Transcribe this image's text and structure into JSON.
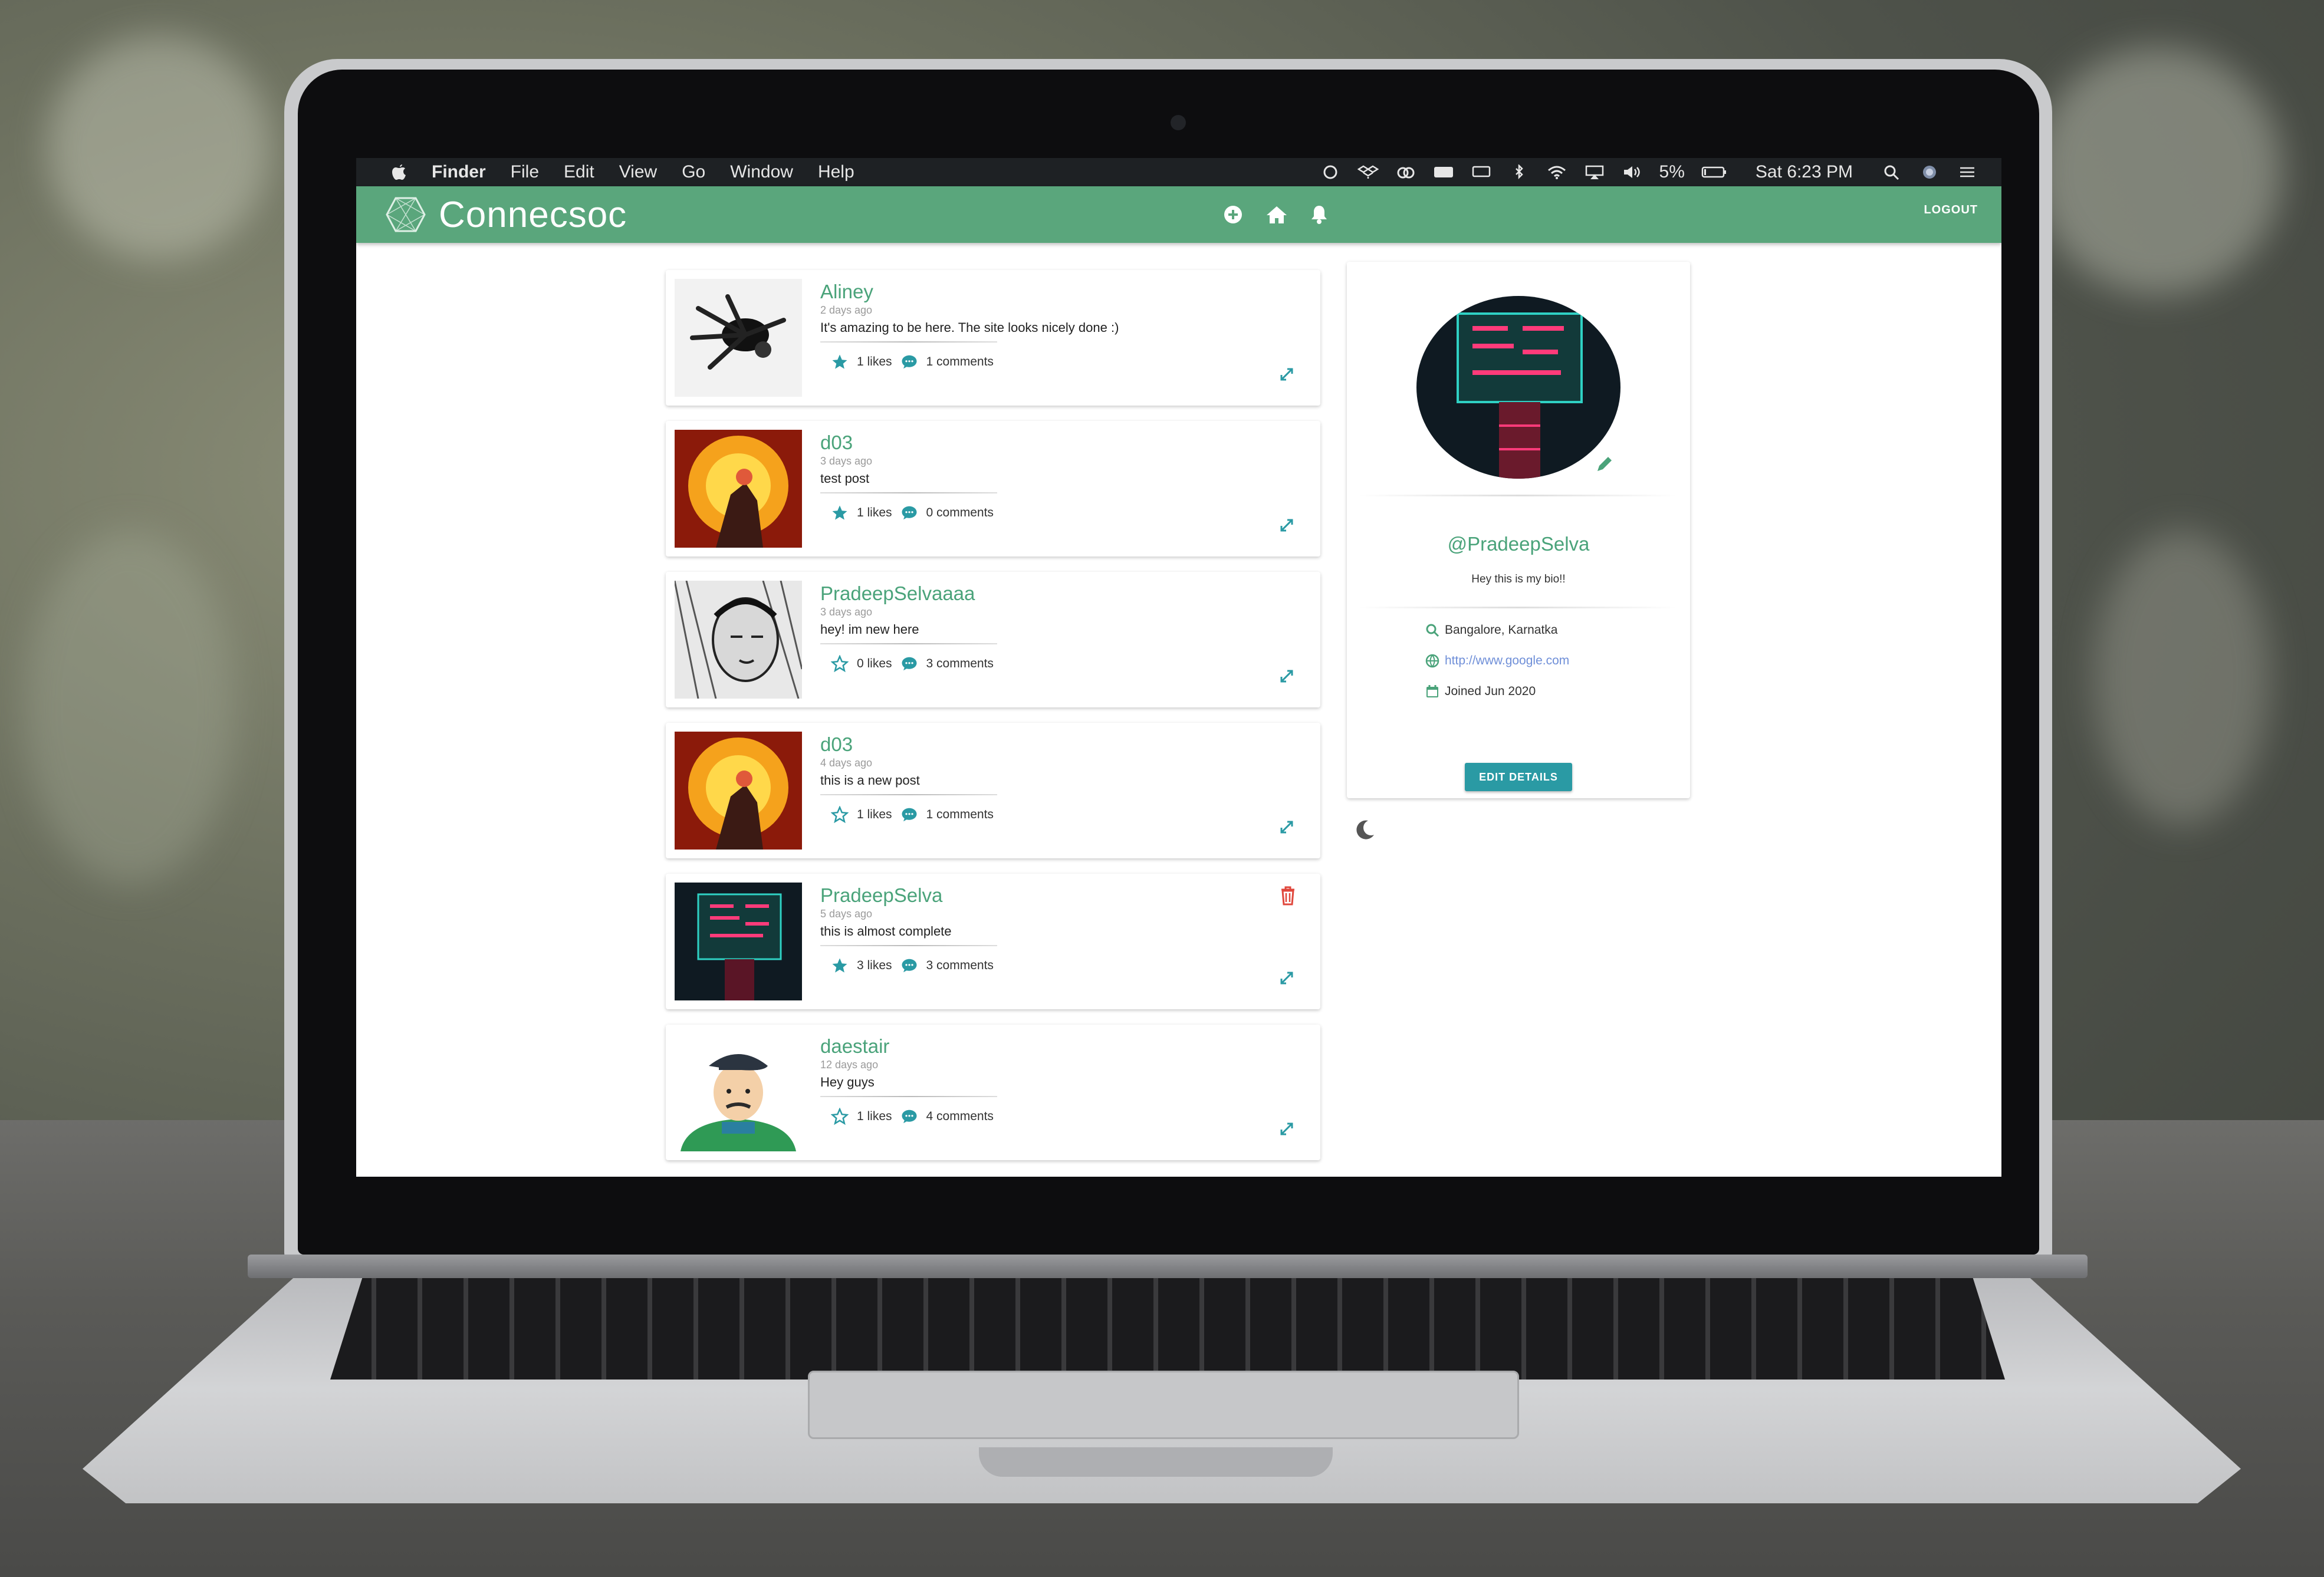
{
  "menubar": {
    "app_name": "Finder",
    "menus": [
      "File",
      "Edit",
      "View",
      "Go",
      "Window",
      "Help"
    ],
    "battery": "5%",
    "clock": "Sat 6:23 PM"
  },
  "app": {
    "brand": "Connecsoc",
    "logout_label": "LOGOUT",
    "accent": "#5aa67c"
  },
  "posts": [
    {
      "user": "Aliney",
      "time": "2 days ago",
      "body": "It's amazing to be here. The site looks nicely done :)",
      "likes": "1 likes",
      "comments": "1 comments",
      "liked": true,
      "deletable": false
    },
    {
      "user": "d03",
      "time": "3 days ago",
      "body": "test post",
      "likes": "1 likes",
      "comments": "0 comments",
      "liked": true,
      "deletable": false
    },
    {
      "user": "PradeepSelvaaaa",
      "time": "3 days ago",
      "body": "hey! im new here",
      "likes": "0 likes",
      "comments": "3 comments",
      "liked": false,
      "deletable": false
    },
    {
      "user": "d03",
      "time": "4 days ago",
      "body": "this is a new post",
      "likes": "1 likes",
      "comments": "1 comments",
      "liked": false,
      "deletable": false
    },
    {
      "user": "PradeepSelva",
      "time": "5 days ago",
      "body": "this is almost complete",
      "likes": "3 likes",
      "comments": "3 comments",
      "liked": true,
      "deletable": true
    },
    {
      "user": "daestair",
      "time": "12 days ago",
      "body": "Hey guys",
      "likes": "1 likes",
      "comments": "4 comments",
      "liked": false,
      "deletable": false
    }
  ],
  "profile": {
    "handle": "@PradeepSelva",
    "bio": "Hey this is my bio!!",
    "location": "Bangalore, Karnatka",
    "website": "http://www.google.com",
    "joined": "Joined Jun 2020",
    "edit_label": "EDIT DETAILS"
  }
}
